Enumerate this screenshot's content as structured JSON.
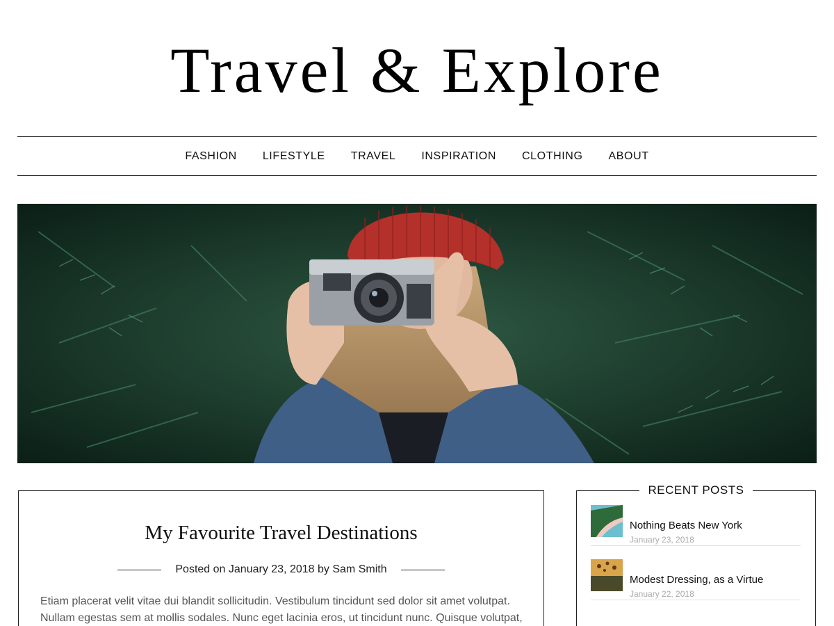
{
  "site": {
    "title": "Travel & Explore"
  },
  "nav": {
    "items": [
      {
        "label": "FASHION"
      },
      {
        "label": "LIFESTYLE"
      },
      {
        "label": "TRAVEL"
      },
      {
        "label": "INSPIRATION"
      },
      {
        "label": "CLOTHING"
      },
      {
        "label": "ABOUT"
      }
    ]
  },
  "hero": {
    "image_icon": "photographer-with-camera-photo"
  },
  "post": {
    "title": "My Favourite Travel Destinations",
    "posted_on_label": "Posted on",
    "date": "January 23, 2018",
    "by_label": "by",
    "author": "Sam Smith",
    "excerpt_line1": "Etiam placerat velit vitae dui blandit sollicitudin. Vestibulum tincidunt sed dolor sit amet volutpat.",
    "excerpt_line2": "Nullam egestas sem at mollis sodales. Nunc eget lacinia eros, ut tincidunt nunc. Quisque volutpat,"
  },
  "sidebar": {
    "widget_title": "RECENT POSTS",
    "recent_posts": [
      {
        "title": "Nothing Beats New York",
        "date": "January 23, 2018",
        "thumb_icon": "beach-coastline-thumbnail"
      },
      {
        "title": "Modest Dressing, as a Virtue",
        "date": "January 22, 2018",
        "thumb_icon": "hot-air-balloons-thumbnail"
      }
    ]
  },
  "colors": {
    "text": "#1a1a1a",
    "muted": "#555555",
    "date_gray": "#aaaaaa",
    "border": "#222222"
  }
}
